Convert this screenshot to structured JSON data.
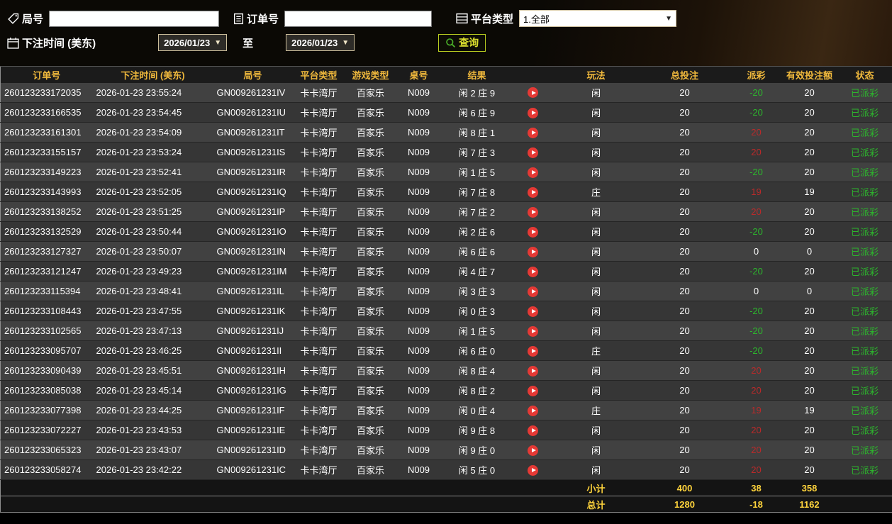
{
  "filters": {
    "round_label": "局号",
    "round_value": "",
    "order_label": "订单号",
    "order_value": "",
    "platform_label": "平台类型",
    "platform_value": "1.全部",
    "time_label": "下注时间 (美东)",
    "date_from": "2026/01/23",
    "to_label": "至",
    "date_to": "2026/01/23",
    "query_label": "查询"
  },
  "icons": {
    "round": "tag-icon",
    "order": "document-icon",
    "platform": "list-icon",
    "time": "calendar-icon",
    "query": "search-icon",
    "replay": "play-icon",
    "dropdown": "chevron-down-icon"
  },
  "colors": {
    "header_text": "#efb83c",
    "total_text": "#ffd43c",
    "payout_positive": "#bb2a2a",
    "payout_negative": "#2db52d",
    "status_paid": "#2db52d",
    "query_accent": "#b9cc20",
    "replay_button": "#e53935"
  },
  "table": {
    "headers": [
      "订单号",
      "下注时间 (美东)",
      "局号",
      "平台类型",
      "游戏类型",
      "桌号",
      "结果",
      "玩法",
      "总投注",
      "派彩",
      "有效投注额",
      "状态"
    ],
    "rows": [
      {
        "order_id": "260123233172035",
        "bet_time": "2026-01-23 23:55:24",
        "round_id": "GN009261231IV",
        "platform": "卡卡湾厅",
        "game": "百家乐",
        "table_no": "N009",
        "result": "闲 2 庄 9",
        "play": "闲",
        "total_bet": "20",
        "payout": "-20",
        "valid_bet": "20",
        "status": "已派彩"
      },
      {
        "order_id": "260123233166535",
        "bet_time": "2026-01-23 23:54:45",
        "round_id": "GN009261231IU",
        "platform": "卡卡湾厅",
        "game": "百家乐",
        "table_no": "N009",
        "result": "闲 6 庄 9",
        "play": "闲",
        "total_bet": "20",
        "payout": "-20",
        "valid_bet": "20",
        "status": "已派彩"
      },
      {
        "order_id": "260123233161301",
        "bet_time": "2026-01-23 23:54:09",
        "round_id": "GN009261231IT",
        "platform": "卡卡湾厅",
        "game": "百家乐",
        "table_no": "N009",
        "result": "闲 8 庄 1",
        "play": "闲",
        "total_bet": "20",
        "payout": "20",
        "valid_bet": "20",
        "status": "已派彩"
      },
      {
        "order_id": "260123233155157",
        "bet_time": "2026-01-23 23:53:24",
        "round_id": "GN009261231IS",
        "platform": "卡卡湾厅",
        "game": "百家乐",
        "table_no": "N009",
        "result": "闲 7 庄 3",
        "play": "闲",
        "total_bet": "20",
        "payout": "20",
        "valid_bet": "20",
        "status": "已派彩"
      },
      {
        "order_id": "260123233149223",
        "bet_time": "2026-01-23 23:52:41",
        "round_id": "GN009261231IR",
        "platform": "卡卡湾厅",
        "game": "百家乐",
        "table_no": "N009",
        "result": "闲 1 庄 5",
        "play": "闲",
        "total_bet": "20",
        "payout": "-20",
        "valid_bet": "20",
        "status": "已派彩"
      },
      {
        "order_id": "260123233143993",
        "bet_time": "2026-01-23 23:52:05",
        "round_id": "GN009261231IQ",
        "platform": "卡卡湾厅",
        "game": "百家乐",
        "table_no": "N009",
        "result": "闲 7 庄 8",
        "play": "庄",
        "total_bet": "20",
        "payout": "19",
        "valid_bet": "19",
        "status": "已派彩"
      },
      {
        "order_id": "260123233138252",
        "bet_time": "2026-01-23 23:51:25",
        "round_id": "GN009261231IP",
        "platform": "卡卡湾厅",
        "game": "百家乐",
        "table_no": "N009",
        "result": "闲 7 庄 2",
        "play": "闲",
        "total_bet": "20",
        "payout": "20",
        "valid_bet": "20",
        "status": "已派彩"
      },
      {
        "order_id": "260123233132529",
        "bet_time": "2026-01-23 23:50:44",
        "round_id": "GN009261231IO",
        "platform": "卡卡湾厅",
        "game": "百家乐",
        "table_no": "N009",
        "result": "闲 2 庄 6",
        "play": "闲",
        "total_bet": "20",
        "payout": "-20",
        "valid_bet": "20",
        "status": "已派彩"
      },
      {
        "order_id": "260123233127327",
        "bet_time": "2026-01-23 23:50:07",
        "round_id": "GN009261231IN",
        "platform": "卡卡湾厅",
        "game": "百家乐",
        "table_no": "N009",
        "result": "闲 6 庄 6",
        "play": "闲",
        "total_bet": "20",
        "payout": "0",
        "valid_bet": "0",
        "status": "已派彩"
      },
      {
        "order_id": "260123233121247",
        "bet_time": "2026-01-23 23:49:23",
        "round_id": "GN009261231IM",
        "platform": "卡卡湾厅",
        "game": "百家乐",
        "table_no": "N009",
        "result": "闲 4 庄 7",
        "play": "闲",
        "total_bet": "20",
        "payout": "-20",
        "valid_bet": "20",
        "status": "已派彩"
      },
      {
        "order_id": "260123233115394",
        "bet_time": "2026-01-23 23:48:41",
        "round_id": "GN009261231IL",
        "platform": "卡卡湾厅",
        "game": "百家乐",
        "table_no": "N009",
        "result": "闲 3 庄 3",
        "play": "闲",
        "total_bet": "20",
        "payout": "0",
        "valid_bet": "0",
        "status": "已派彩"
      },
      {
        "order_id": "260123233108443",
        "bet_time": "2026-01-23 23:47:55",
        "round_id": "GN009261231IK",
        "platform": "卡卡湾厅",
        "game": "百家乐",
        "table_no": "N009",
        "result": "闲 0 庄 3",
        "play": "闲",
        "total_bet": "20",
        "payout": "-20",
        "valid_bet": "20",
        "status": "已派彩"
      },
      {
        "order_id": "260123233102565",
        "bet_time": "2026-01-23 23:47:13",
        "round_id": "GN009261231IJ",
        "platform": "卡卡湾厅",
        "game": "百家乐",
        "table_no": "N009",
        "result": "闲 1 庄 5",
        "play": "闲",
        "total_bet": "20",
        "payout": "-20",
        "valid_bet": "20",
        "status": "已派彩"
      },
      {
        "order_id": "260123233095707",
        "bet_time": "2026-01-23 23:46:25",
        "round_id": "GN009261231II",
        "platform": "卡卡湾厅",
        "game": "百家乐",
        "table_no": "N009",
        "result": "闲 6 庄 0",
        "play": "庄",
        "total_bet": "20",
        "payout": "-20",
        "valid_bet": "20",
        "status": "已派彩"
      },
      {
        "order_id": "260123233090439",
        "bet_time": "2026-01-23 23:45:51",
        "round_id": "GN009261231IH",
        "platform": "卡卡湾厅",
        "game": "百家乐",
        "table_no": "N009",
        "result": "闲 8 庄 4",
        "play": "闲",
        "total_bet": "20",
        "payout": "20",
        "valid_bet": "20",
        "status": "已派彩"
      },
      {
        "order_id": "260123233085038",
        "bet_time": "2026-01-23 23:45:14",
        "round_id": "GN009261231IG",
        "platform": "卡卡湾厅",
        "game": "百家乐",
        "table_no": "N009",
        "result": "闲 8 庄 2",
        "play": "闲",
        "total_bet": "20",
        "payout": "20",
        "valid_bet": "20",
        "status": "已派彩"
      },
      {
        "order_id": "260123233077398",
        "bet_time": "2026-01-23 23:44:25",
        "round_id": "GN009261231IF",
        "platform": "卡卡湾厅",
        "game": "百家乐",
        "table_no": "N009",
        "result": "闲 0 庄 4",
        "play": "庄",
        "total_bet": "20",
        "payout": "19",
        "valid_bet": "19",
        "status": "已派彩"
      },
      {
        "order_id": "260123233072227",
        "bet_time": "2026-01-23 23:43:53",
        "round_id": "GN009261231IE",
        "platform": "卡卡湾厅",
        "game": "百家乐",
        "table_no": "N009",
        "result": "闲 9 庄 8",
        "play": "闲",
        "total_bet": "20",
        "payout": "20",
        "valid_bet": "20",
        "status": "已派彩"
      },
      {
        "order_id": "260123233065323",
        "bet_time": "2026-01-23 23:43:07",
        "round_id": "GN009261231ID",
        "platform": "卡卡湾厅",
        "game": "百家乐",
        "table_no": "N009",
        "result": "闲 9 庄 0",
        "play": "闲",
        "total_bet": "20",
        "payout": "20",
        "valid_bet": "20",
        "status": "已派彩"
      },
      {
        "order_id": "260123233058274",
        "bet_time": "2026-01-23 23:42:22",
        "round_id": "GN009261231IC",
        "platform": "卡卡湾厅",
        "game": "百家乐",
        "table_no": "N009",
        "result": "闲 5 庄 0",
        "play": "闲",
        "total_bet": "20",
        "payout": "20",
        "valid_bet": "20",
        "status": "已派彩"
      }
    ],
    "subtotal": {
      "label": "小计",
      "total_bet": "400",
      "payout": "38",
      "valid_bet": "358"
    },
    "grand_total": {
      "label": "总计",
      "total_bet": "1280",
      "payout": "-18",
      "valid_bet": "1162"
    }
  }
}
